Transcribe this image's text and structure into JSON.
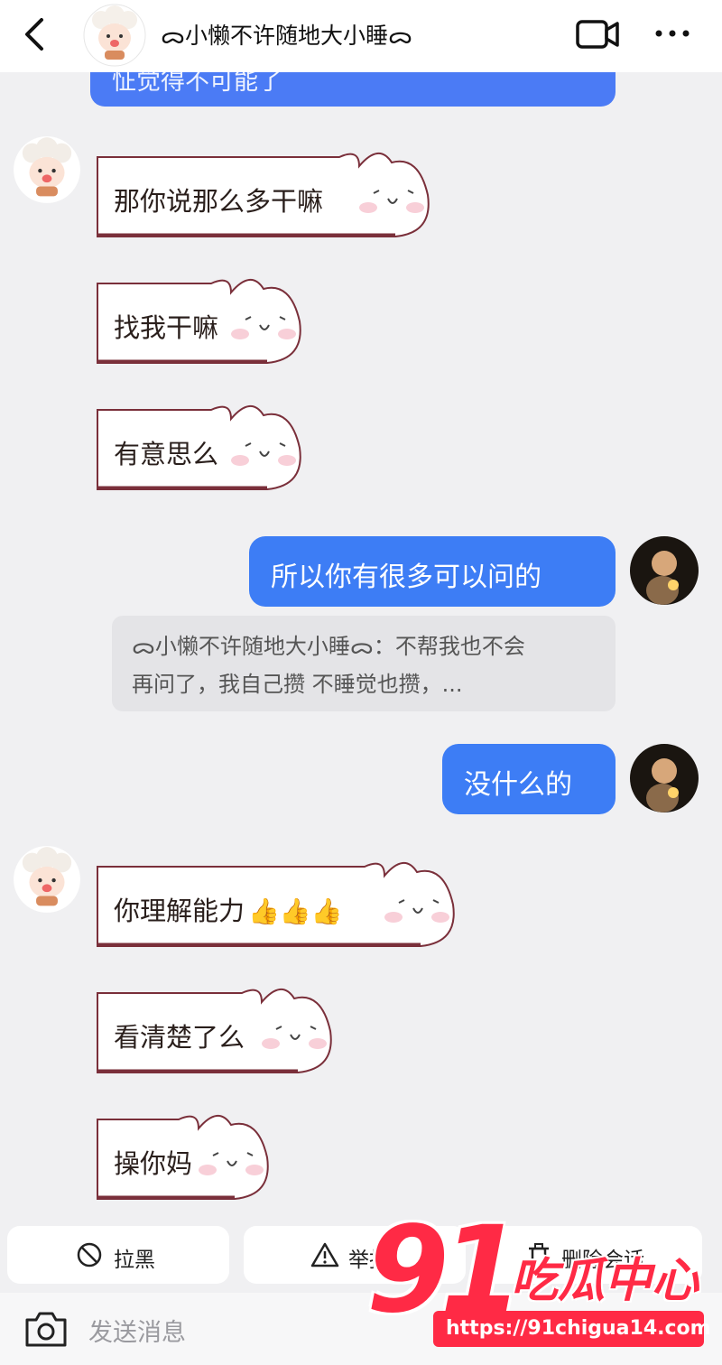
{
  "header": {
    "title": "ᯅ小懒不许随地大小睡ᯅ"
  },
  "messages": {
    "partial": "怔觉得不可能了",
    "m1": "那你说那么多干嘛",
    "m2": "找我干嘛",
    "m3": "有意思么",
    "m4": "所以你有很多可以问的",
    "quote_line1": "ᯅ小懒不许随地大小睡ᯅ：不帮我也不会",
    "quote_line2": "再问了，我自己攒 不睡觉也攒，...",
    "m5": "没什么的",
    "m6": "你理解能力",
    "m6_emoji": "👍👍👍",
    "m7": "看清楚了么",
    "m8": "操你妈"
  },
  "actions": {
    "block": "拉黑",
    "report": "举报",
    "delete": "删除会话"
  },
  "input": {
    "placeholder": "发送消息"
  },
  "watermark": {
    "number": "91",
    "name": "吃瓜中心",
    "url": "https://91chigua14.com"
  },
  "colors": {
    "blue_bubble": "#3d7df5",
    "background": "#f0f0f2",
    "watermark_red": "#ff2a45"
  },
  "icons": [
    "back-icon",
    "sheep-avatar-icon",
    "video-camera-icon",
    "more-icon",
    "block-icon",
    "warning-icon",
    "trash-icon",
    "camera-icon"
  ]
}
